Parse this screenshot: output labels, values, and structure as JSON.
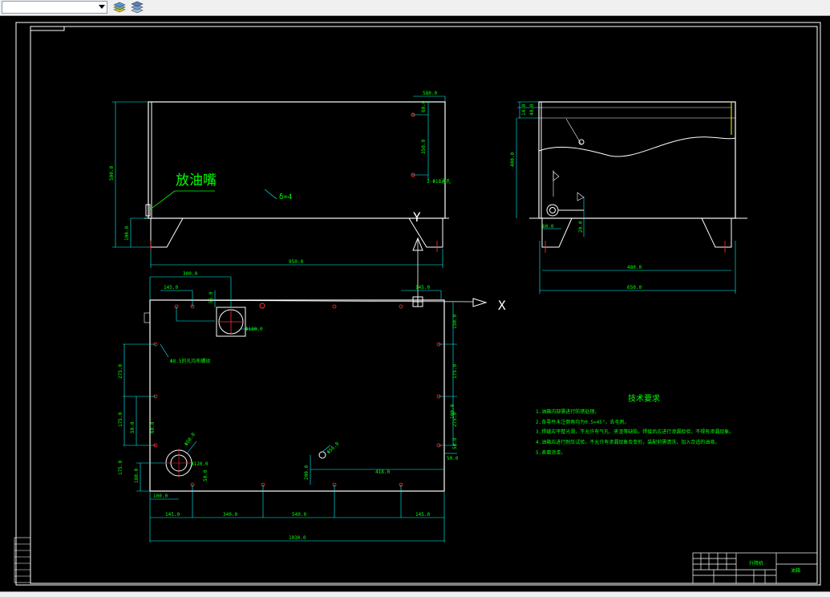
{
  "toolbar": {
    "layer_combo_value": "",
    "icons": [
      "layer-states-icon",
      "layer-properties-icon"
    ]
  },
  "drawing": {
    "label_drain": "放油嘴",
    "label_thickness": "δ=4",
    "axis_x": "X",
    "axis_y": "Y",
    "front_view_dims": [
      "580.0",
      "60.0",
      "350.0",
      "2-Φ18通孔",
      "500.0",
      "100.0",
      "950.0"
    ],
    "side_view_dims": [
      "14.0",
      "40.0",
      "400.0",
      "60.0",
      "20.0",
      "480.0",
      "650.0"
    ],
    "plan_view_dims": [
      "300.0",
      "145.0",
      "55.0",
      "Φ180.0",
      "145.0",
      "150.0",
      "Φ8.5的孔均布螺纹",
      "275.0",
      "175.0",
      "275.0",
      "175.0",
      "50.0",
      "175.0",
      "180.0",
      "100.0",
      "Φ60.0",
      "50.0",
      "Φ120.0",
      "Φ56.0",
      "200.0",
      "50.0",
      "418.0",
      "50.0",
      "145.0",
      "340.0",
      "540.0",
      "145.0",
      "1030.0",
      "100.0",
      "60.0"
    ],
    "tech_title": "技术要求",
    "tech_items": [
      "1.油箱内部需进行防锈处理。",
      "2.各零件未注倒角均为0.5×45°，去毛刺。",
      "3.焊缝应平整光滑，不允许有气孔、夹渣等缺陷，焊接后应进行渗漏检验，不得有渗漏现象。",
      "4.油箱应进行耐压试验，不允许有渗漏现象及变形，装配前需清洗，加入合适的油液。",
      "5.表面涂漆。"
    ],
    "title_block_drawing_name": "升降机",
    "title_block_part_name": "油箱"
  }
}
